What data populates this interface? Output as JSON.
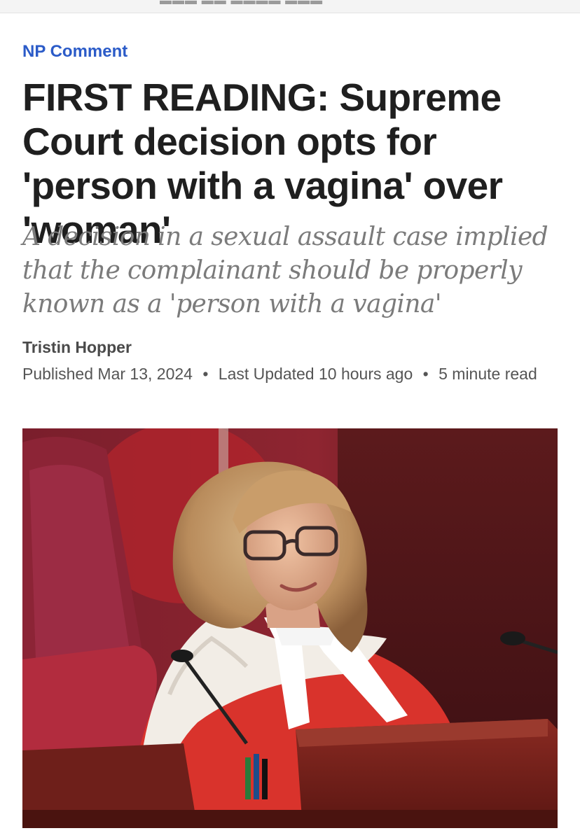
{
  "section": {
    "label": "NP Comment"
  },
  "article": {
    "headline": "FIRST READING: Supreme Court decision opts for 'person with a vagina' over 'woman'",
    "dek": "A decision in a sexual assault case implied that the complainant should be properly known as a 'person with a vagina'",
    "author": "Tristin Hopper",
    "published": "Published Mar 13, 2024",
    "updated": "Last Updated 10 hours ago",
    "read_time": "5 minute read",
    "separator": "•"
  },
  "image": {
    "subject": "judge-in-red-robes-photo"
  },
  "colors": {
    "section_link": "#2b5bc8",
    "headline": "#1f1f1f",
    "dek": "#7b7b7b",
    "meta": "#555555"
  }
}
